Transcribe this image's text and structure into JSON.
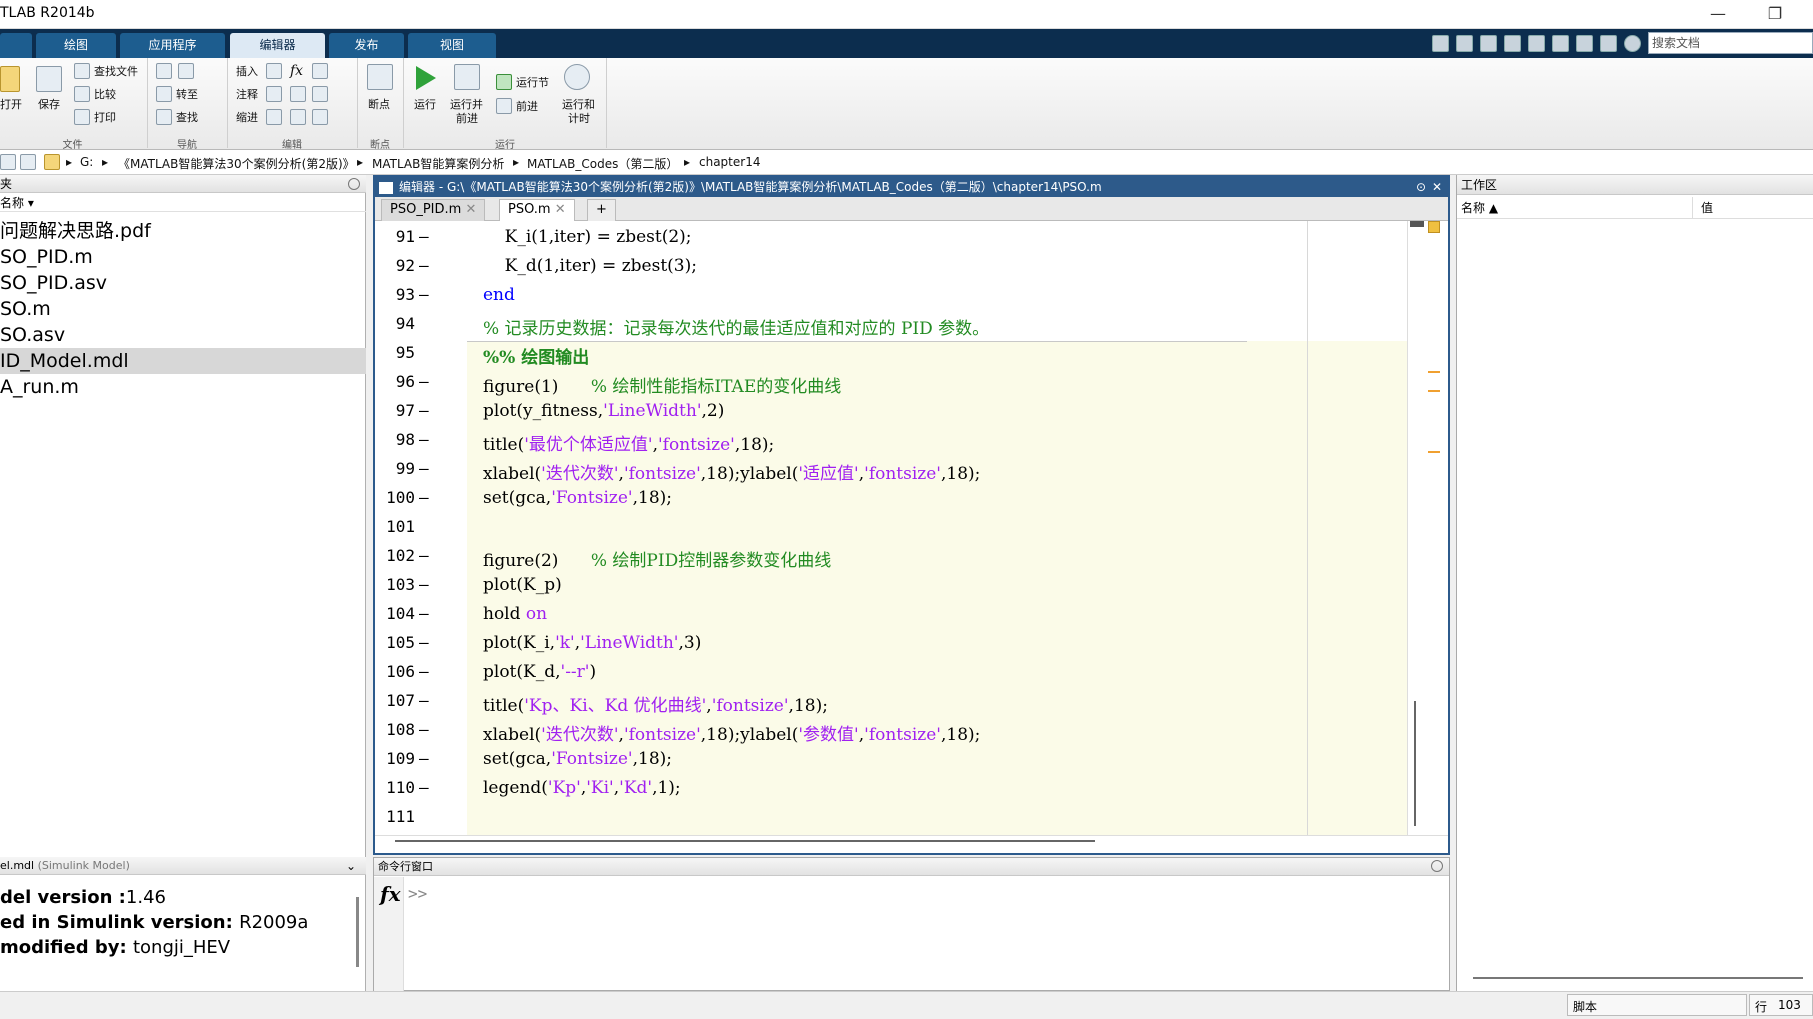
{
  "window": {
    "title": "TLAB R2014b",
    "minimize_glyph": "—",
    "restore_glyph": "❐"
  },
  "ribbon_tabs": [
    "绘图",
    "应用程序",
    "编辑器",
    "发布",
    "视图"
  ],
  "search_placeholder": "搜索文档",
  "ribbon": {
    "file_group": {
      "open": "打开",
      "save": "保存",
      "find_files": "查找文件",
      "compare": "比较",
      "print": "打印",
      "label": "文件"
    },
    "nav_group": {
      "goto": "转至",
      "find": "查找",
      "label": "导航"
    },
    "edit_group": {
      "insert": "插入",
      "comment": "注释",
      "indent": "缩进",
      "fx": "fx",
      "label": "编辑"
    },
    "bp_group": {
      "breakpoints": "断点",
      "label": "断点"
    },
    "run_group": {
      "run": "运行",
      "run_advance_1": "运行并",
      "run_advance_2": "前进",
      "run_section": "运行节",
      "advance": "前进",
      "run_time_1": "运行和",
      "run_time_2": "计时",
      "label": "运行"
    }
  },
  "address": {
    "drive": "G:",
    "crumbs": [
      "《MATLAB智能算法30个案例分析(第2版)》",
      "MATLAB智能算案例分析",
      "MATLAB_Codes（第二版）",
      "chapter14"
    ]
  },
  "current_folder": {
    "header": "夹",
    "column": "名称",
    "files": [
      "问题解决思路.pdf",
      "SO_PID.m",
      "SO_PID.asv",
      "SO.m",
      "SO.asv",
      "ID_Model.mdl",
      "A_run.m"
    ],
    "selected_index": 5
  },
  "details": {
    "header_name": "el.mdl",
    "header_type": "(Simulink Model)",
    "lines": [
      {
        "label": "del version :",
        "value": "1.46"
      },
      {
        "label": "ed in Simulink version: ",
        "value": "R2009a"
      },
      {
        "label": " modified by: ",
        "value": "tongji_HEV"
      }
    ]
  },
  "editor": {
    "title": "编辑器 - G:\\《MATLAB智能算法30个案例分析(第2版)》\\MATLAB智能算案例分析\\MATLAB_Codes（第二版）\\chapter14\\PSO.m",
    "tabs": [
      "PSO_PID.m",
      "PSO.m"
    ],
    "active_tab": 1,
    "add_tab": "+",
    "lines": [
      {
        "n": "91",
        "d": "—",
        "code": [
          {
            "t": "    K_i(1,iter) = zbest(2);",
            "c": ""
          }
        ]
      },
      {
        "n": "92",
        "d": "—",
        "code": [
          {
            "t": "    K_d(1,iter) = zbest(3);",
            "c": ""
          }
        ]
      },
      {
        "n": "93",
        "d": "—",
        "code": [
          {
            "t": "end",
            "c": "kw"
          }
        ]
      },
      {
        "n": "94",
        "d": "",
        "code": [
          {
            "t": "% 记录历史数据：记录每次迭代的最佳适应值和对应的 PID 参数。",
            "c": "cm"
          }
        ]
      },
      {
        "n": "95",
        "d": "",
        "code": [
          {
            "t": "%% 绘图输出",
            "c": "cellhdr"
          }
        ]
      },
      {
        "n": "96",
        "d": "—",
        "code": [
          {
            "t": "figure(1)      ",
            "c": ""
          },
          {
            "t": "% 绘制性能指标ITAE的变化曲线",
            "c": "cm"
          }
        ]
      },
      {
        "n": "97",
        "d": "—",
        "code": [
          {
            "t": "plot(y_fitness,",
            "c": ""
          },
          {
            "t": "'LineWidth'",
            "c": "str"
          },
          {
            "t": ",2)",
            "c": ""
          }
        ]
      },
      {
        "n": "98",
        "d": "—",
        "code": [
          {
            "t": "title(",
            "c": ""
          },
          {
            "t": "'最优个体适应值'",
            "c": "str"
          },
          {
            "t": ",",
            "c": ""
          },
          {
            "t": "'fontsize'",
            "c": "str"
          },
          {
            "t": ",18);",
            "c": ""
          }
        ]
      },
      {
        "n": "99",
        "d": "—",
        "code": [
          {
            "t": "xlabel(",
            "c": ""
          },
          {
            "t": "'迭代次数'",
            "c": "str"
          },
          {
            "t": ",",
            "c": ""
          },
          {
            "t": "'fontsize'",
            "c": "str"
          },
          {
            "t": ",18);ylabel(",
            "c": ""
          },
          {
            "t": "'适应值'",
            "c": "str"
          },
          {
            "t": ",",
            "c": ""
          },
          {
            "t": "'fontsize'",
            "c": "str"
          },
          {
            "t": ",18);",
            "c": ""
          }
        ]
      },
      {
        "n": "100",
        "d": "—",
        "code": [
          {
            "t": "set(gca,",
            "c": ""
          },
          {
            "t": "'Fontsize'",
            "c": "str"
          },
          {
            "t": ",18);",
            "c": ""
          }
        ]
      },
      {
        "n": "101",
        "d": "",
        "code": []
      },
      {
        "n": "102",
        "d": "—",
        "code": [
          {
            "t": "figure(2)      ",
            "c": ""
          },
          {
            "t": "% 绘制PID控制器参数变化曲线",
            "c": "cm"
          }
        ]
      },
      {
        "n": "103",
        "d": "—",
        "code": [
          {
            "t": "plot(K_p)",
            "c": ""
          }
        ]
      },
      {
        "n": "104",
        "d": "—",
        "code": [
          {
            "t": "hold ",
            "c": ""
          },
          {
            "t": "on",
            "c": "str"
          }
        ]
      },
      {
        "n": "105",
        "d": "—",
        "code": [
          {
            "t": "plot(K_i,",
            "c": ""
          },
          {
            "t": "'k'",
            "c": "str"
          },
          {
            "t": ",",
            "c": ""
          },
          {
            "t": "'LineWidth'",
            "c": "str"
          },
          {
            "t": ",3)",
            "c": ""
          }
        ]
      },
      {
        "n": "106",
        "d": "—",
        "code": [
          {
            "t": "plot(K_d,",
            "c": ""
          },
          {
            "t": "'--r'",
            "c": "str"
          },
          {
            "t": ")",
            "c": ""
          }
        ]
      },
      {
        "n": "107",
        "d": "—",
        "code": [
          {
            "t": "title(",
            "c": ""
          },
          {
            "t": "'Kp、Ki、Kd 优化曲线'",
            "c": "str"
          },
          {
            "t": ",",
            "c": ""
          },
          {
            "t": "'fontsize'",
            "c": "str"
          },
          {
            "t": ",18);",
            "c": ""
          }
        ]
      },
      {
        "n": "108",
        "d": "—",
        "code": [
          {
            "t": "xlabel(",
            "c": ""
          },
          {
            "t": "'迭代次数'",
            "c": "str"
          },
          {
            "t": ",",
            "c": ""
          },
          {
            "t": "'fontsize'",
            "c": "str"
          },
          {
            "t": ",18);ylabel(",
            "c": ""
          },
          {
            "t": "'参数值'",
            "c": "str"
          },
          {
            "t": ",",
            "c": ""
          },
          {
            "t": "'fontsize'",
            "c": "str"
          },
          {
            "t": ",18);",
            "c": ""
          }
        ]
      },
      {
        "n": "109",
        "d": "—",
        "code": [
          {
            "t": "set(gca,",
            "c": ""
          },
          {
            "t": "'Fontsize'",
            "c": "str"
          },
          {
            "t": ",18);",
            "c": ""
          }
        ]
      },
      {
        "n": "110",
        "d": "—",
        "code": [
          {
            "t": "legend(",
            "c": ""
          },
          {
            "t": "'Kp'",
            "c": "str"
          },
          {
            "t": ",",
            "c": ""
          },
          {
            "t": "'Ki'",
            "c": "str"
          },
          {
            "t": ",",
            "c": ""
          },
          {
            "t": "'Kd'",
            "c": "str"
          },
          {
            "t": ",1);",
            "c": ""
          }
        ]
      },
      {
        "n": "111",
        "d": "",
        "code": []
      }
    ]
  },
  "command_window": {
    "title": "命令行窗口",
    "fx": "fx",
    "prompt": ">>"
  },
  "workspace": {
    "title": "工作区",
    "col_name": "名称 ▲",
    "col_value": "值"
  },
  "status": {
    "type": "脚本",
    "row_label": "行",
    "row_value": "103"
  },
  "colors": {
    "keyword": "#0000ff",
    "string": "#a020f0",
    "comment": "#228b22",
    "cell_bg": "#fbfbe8",
    "ribbon_dark": "#0c2d4e"
  }
}
